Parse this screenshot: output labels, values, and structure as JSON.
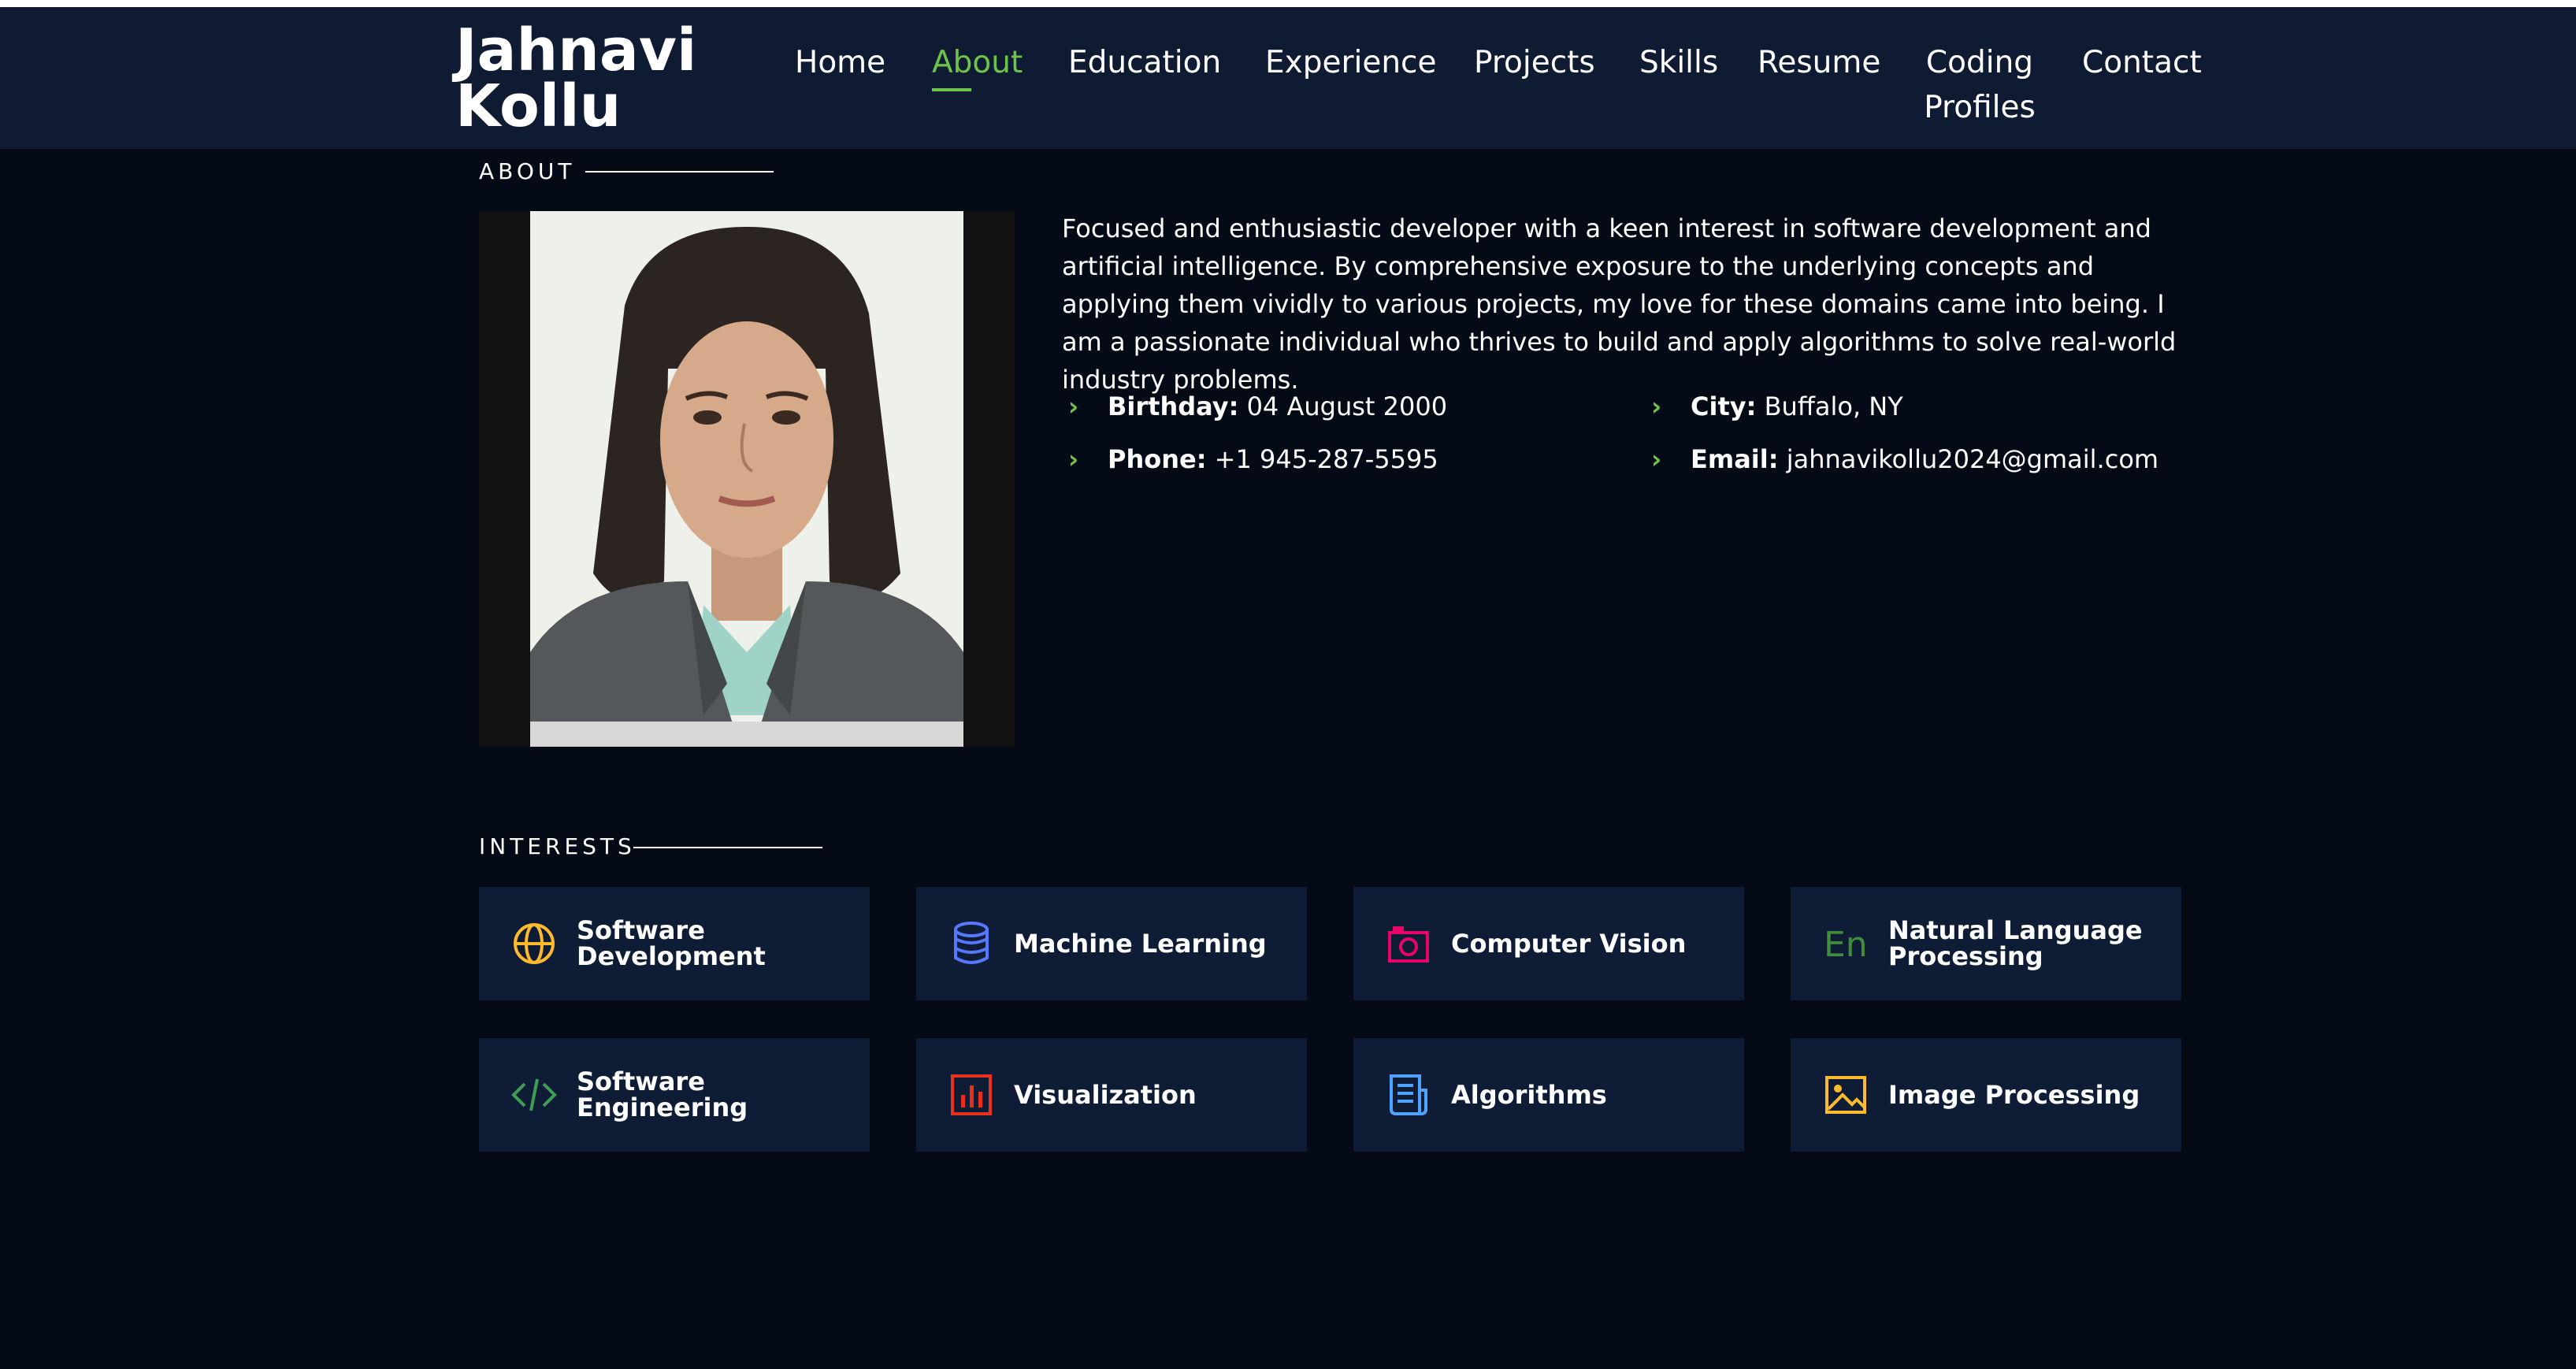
{
  "brand": {
    "name_line1": "Jahnavi",
    "name_line2": "Kollu"
  },
  "nav": {
    "items": [
      {
        "label": "Home",
        "active": false
      },
      {
        "label": "About",
        "active": true
      },
      {
        "label": "Education",
        "active": false
      },
      {
        "label": "Experience",
        "active": false
      },
      {
        "label": "Projects",
        "active": false
      },
      {
        "label": "Skills",
        "active": false
      },
      {
        "label": "Resume",
        "active": false
      },
      {
        "label": "Coding Profiles",
        "active": false
      },
      {
        "label": "Contact",
        "active": false
      }
    ]
  },
  "about": {
    "section_title": "ABOUT",
    "bio": "Focused and enthusiastic developer with a keen interest in software development and artificial intelligence. By comprehensive exposure to the underlying concepts and applying them vividly to various projects, my love for these domains came into being. I am a passionate individual who thrives to build and apply algorithms to solve real-world industry problems.",
    "details": {
      "birthday": {
        "label": "Birthday:",
        "value": "04 August 2000"
      },
      "city": {
        "label": "City:",
        "value": "Buffalo, NY"
      },
      "phone": {
        "label": "Phone:",
        "value": "+1 945-287-5595"
      },
      "email": {
        "label": "Email:",
        "value": "jahnavikollu2024@gmail.com"
      }
    }
  },
  "interests": {
    "section_title": "INTERESTS",
    "items": [
      {
        "label": "Software Development",
        "icon": "globe-icon",
        "color": "#ffbb2c"
      },
      {
        "label": "Machine Learning",
        "icon": "database-icon",
        "color": "#5578ff"
      },
      {
        "label": "Computer Vision",
        "icon": "camera-icon",
        "color": "#e80368"
      },
      {
        "label": "Natural Language Processing",
        "icon": "language-icon",
        "color": "#47aeff"
      },
      {
        "label": "Software Engineering",
        "icon": "code-icon",
        "color": "#11dbcf"
      },
      {
        "label": "Visualization",
        "icon": "bar-chart-icon",
        "color": "#e8301c"
      },
      {
        "label": "Algorithms",
        "icon": "document-icon",
        "color": "#4da3ff"
      },
      {
        "label": "Image Processing",
        "icon": "image-icon",
        "color": "#ffbb2c"
      }
    ]
  },
  "colors": {
    "accent_green": "#6ec44b",
    "header_bg": "#0e1b32",
    "page_bg": "#040b17",
    "card_bg": "#0f1c35"
  }
}
